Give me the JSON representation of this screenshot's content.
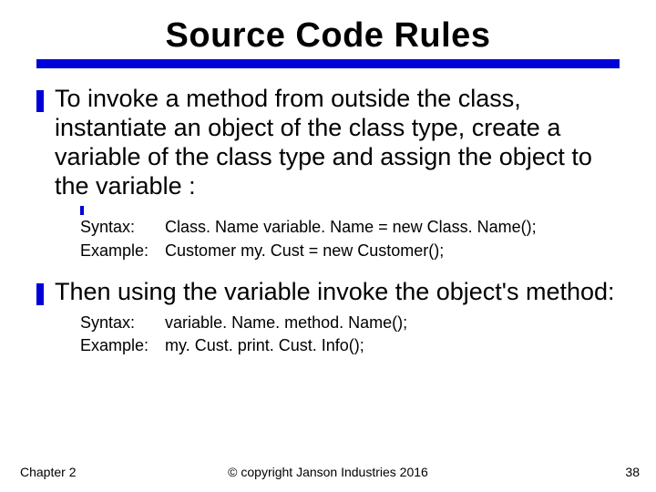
{
  "title": "Source Code Rules",
  "bullets": [
    {
      "text": "To invoke a method from outside the class, instantiate an object of the class type, create a variable of the class type and assign the object to the variable :",
      "defs": {
        "syntax_label": "Syntax:",
        "syntax_value": "Class. Name  variable. Name  =  new  Class. Name();",
        "example_label": "Example:",
        "example_value": "Customer  my. Cust  =  new  Customer();"
      }
    },
    {
      "text": "Then using the variable invoke the object's method:",
      "defs": {
        "syntax_label": "Syntax:",
        "syntax_value": "variable. Name. method. Name();",
        "example_label": "Example:",
        "example_value": "my. Cust. print. Cust. Info();"
      }
    }
  ],
  "footer": {
    "left": "Chapter 2",
    "center": "© copyright Janson Industries 2016",
    "right": "38"
  }
}
